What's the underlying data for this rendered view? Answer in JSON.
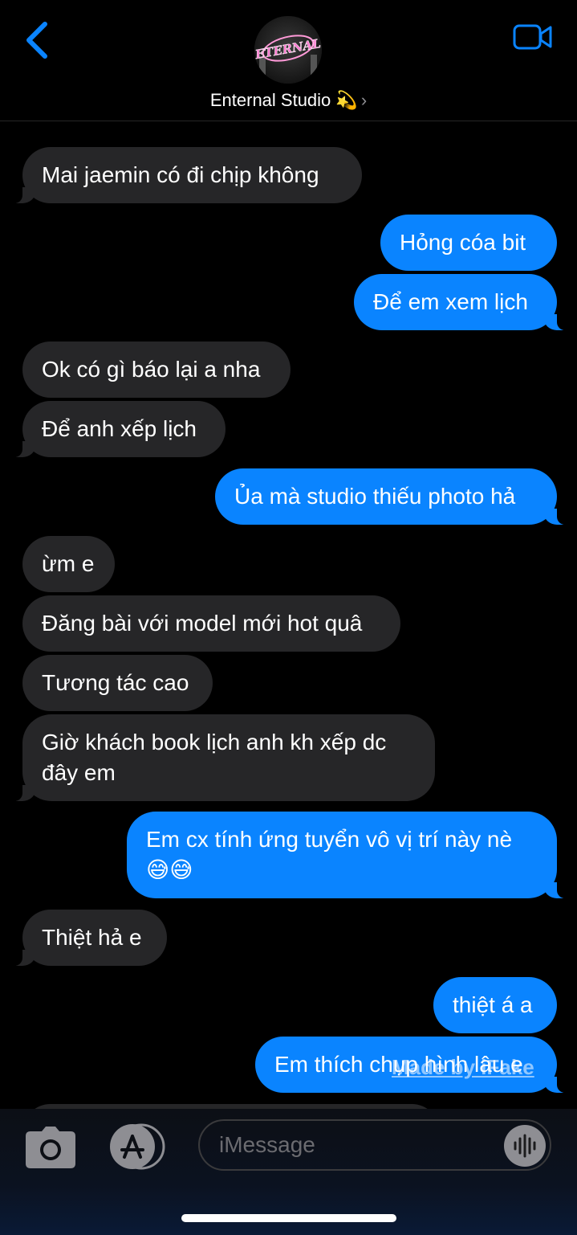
{
  "header": {
    "contact_name": "Enternal Studio 💫",
    "chevron": "›",
    "avatar_label": "ETERNAL",
    "icons": {
      "back": "chevron-left-icon",
      "video": "video-camera-icon"
    },
    "accent": "#0a84ff"
  },
  "messages": [
    {
      "side": "in",
      "text": "Mai jaemin có đi chịp không"
    },
    {
      "side": "out",
      "text": "Hỏng cóa bit"
    },
    {
      "side": "out",
      "text": "Để em xem lịch"
    },
    {
      "side": "in",
      "text": "Ok có gì báo lại a nha"
    },
    {
      "side": "in",
      "text": "Để anh xếp lịch"
    },
    {
      "side": "out",
      "text": "Ủa mà studio thiếu photo hả"
    },
    {
      "side": "in",
      "text": "ừm e"
    },
    {
      "side": "in",
      "text": "Đăng bài với model mới hot quâ"
    },
    {
      "side": "in",
      "text": "Tương tác cao"
    },
    {
      "side": "in",
      "text": "Giờ khách book lịch anh kh xếp dc đây em"
    },
    {
      "side": "out",
      "text": "Em cx tính ứng tuyển vô vị trí này nè 😅😅"
    },
    {
      "side": "in",
      "text": "Thiệt hả e"
    },
    {
      "side": "out",
      "text": "thiệt á a"
    },
    {
      "side": "out",
      "text": "Em thích chụp hình lâu e"
    }
  ],
  "watermark": "Made by iFake",
  "composer": {
    "placeholder": "iMessage",
    "icons": {
      "camera": "camera-icon",
      "apps": "app-store-icon",
      "audio": "audio-waveform-icon"
    }
  },
  "colors": {
    "incoming": "#262628",
    "outgoing": "#0a84ff",
    "background": "#000000"
  }
}
